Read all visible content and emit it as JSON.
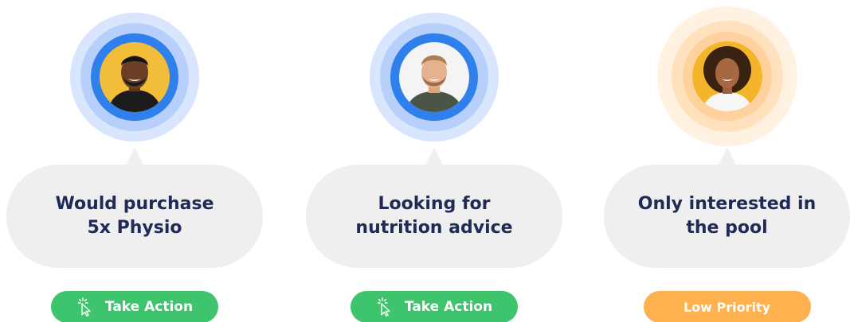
{
  "leads": [
    {
      "note": "Would purchase 5x Physio",
      "note_line1": "Would purchase",
      "note_line2": "5x Physio",
      "action_label": "Take Action",
      "status": "high"
    },
    {
      "note": "Looking for nutrition advice",
      "note_line1": "Looking for",
      "note_line2": "nutrition advice",
      "action_label": "Take Action",
      "status": "high"
    },
    {
      "note": "Only interested in the pool",
      "note_line1": "Only interested in",
      "note_line2": "the pool",
      "action_label": "Low Priority",
      "status": "low"
    }
  ],
  "colors": {
    "accent_blue": "#2f80ed",
    "accent_orange": "#ffb04f",
    "action_green": "#3ec46d",
    "bubble_bg": "#efefef",
    "text_navy": "#1f2a56"
  },
  "icons": {
    "action": "click-cursor-icon"
  }
}
